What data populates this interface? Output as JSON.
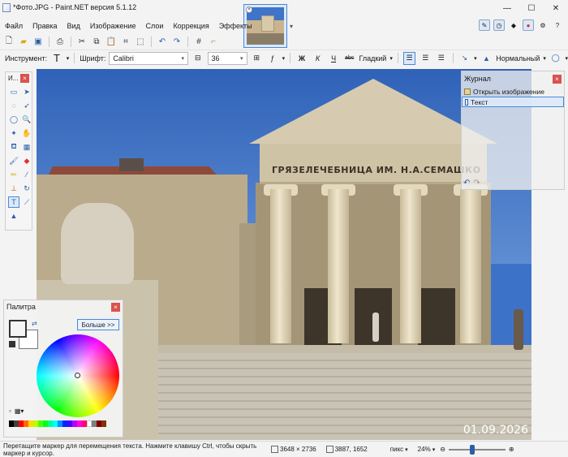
{
  "window": {
    "title": "*Фото.JPG - Paint.NET версия 5.1.12",
    "minimize": "—",
    "maximize": "☐",
    "close": "✕"
  },
  "menu": [
    "Файл",
    "Правка",
    "Вид",
    "Изображение",
    "Слои",
    "Коррекция",
    "Эффекты"
  ],
  "right_toolbar_icons": [
    "tools-window-icon",
    "history-window-icon",
    "layers-window-icon",
    "palette-window-icon",
    "settings-gear-icon",
    "help-icon"
  ],
  "text_toolbar": {
    "tool_label": "Инструмент:",
    "font_label": "Шрифт:",
    "font_value": "Calibri",
    "size_value": "36",
    "bold": "Ж",
    "italic": "К",
    "underline": "Ч",
    "strike": "abc",
    "smoothing": "Гладкий",
    "blend_mode": "Нормальный"
  },
  "tools_panel": {
    "title": "И..."
  },
  "history_panel": {
    "title": "Журнал",
    "items": [
      "Открыть изображение",
      "Текст"
    ]
  },
  "palette_panel": {
    "title": "Палитра",
    "more_button": "Больше >>"
  },
  "canvas": {
    "inscription": "ГРЯЗЕЛЕЧЕБНИЦА ИМ. Н.А.СЕМАШКО",
    "date_stamp": "01.09.2026"
  },
  "status": {
    "message": "Перетащите маркер для перемещения текста. Нажмите клавишу Ctrl, чтобы скрыть маркер и курсор.",
    "image_size": "3648 × 2736",
    "cursor_pos": "3887, 1652",
    "units": "пикс",
    "zoom": "24%"
  }
}
